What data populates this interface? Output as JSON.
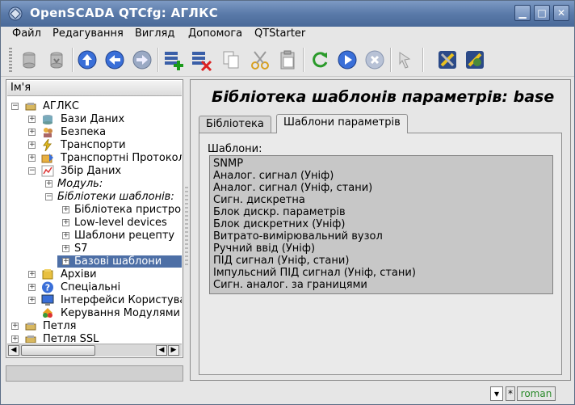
{
  "window": {
    "title": "OpenSCADA QTCfg: АГЛКС"
  },
  "menu": [
    {
      "label": "Файл"
    },
    {
      "label": "Редагування"
    },
    {
      "label": "Вигляд"
    },
    {
      "label": "Допомога"
    },
    {
      "label": "QTStarter"
    }
  ],
  "tree": {
    "header": "Ім'я",
    "nodes": [
      {
        "label": "АГЛКС",
        "icon": "station-icon"
      },
      {
        "label": "Бази Даних",
        "icon": "database-icon"
      },
      {
        "label": "Безпека",
        "icon": "security-icon"
      },
      {
        "label": "Транспорти",
        "icon": "lightning-icon"
      },
      {
        "label": "Транспортні Протокол",
        "icon": "protocol-icon"
      },
      {
        "label": "Збір Даних",
        "icon": "chart-icon"
      },
      {
        "label": "Модуль:"
      },
      {
        "label": "Бібліотеки шаблонів:"
      },
      {
        "label": "Бібліотека пристро"
      },
      {
        "label": "Low-level devices"
      },
      {
        "label": "Шаблони рецепту"
      },
      {
        "label": "S7"
      },
      {
        "label": "Базові шаблони"
      },
      {
        "label": "Архіви",
        "icon": "archive-icon"
      },
      {
        "label": "Спеціальні",
        "icon": "help-icon"
      },
      {
        "label": "Інтерфейси Користува",
        "icon": "monitor-icon"
      },
      {
        "label": "Керування Модулями",
        "icon": "modules-icon"
      },
      {
        "label": "Петля",
        "icon": "station-icon"
      },
      {
        "label": "Петля SSL",
        "icon": "station-icon"
      }
    ]
  },
  "page": {
    "title": "Бібліотека шаблонів параметрів: base",
    "tabs": [
      {
        "label": "Бібліотека"
      },
      {
        "label": "Шаблони параметрів"
      }
    ],
    "templates_label": "Шаблони:",
    "templates": [
      "SNMP",
      "Аналог. сигнал (Уніф)",
      "Аналог. сигнал (Уніф, стани)",
      "Сигн. дискретна",
      "Блок дискр. параметрів",
      "Блок дискретних (Уніф)",
      "Витрато-вимірювальний вузол",
      "Ручний ввід (Уніф)",
      "ПІД сигнал (Уніф, стани)",
      "Імпульсний ПІД сигнал (Уніф, стани)",
      "Сигн. аналог. за границями"
    ]
  },
  "statusbar": {
    "modified": "*",
    "user": "roman"
  },
  "colors": {
    "titlebar": "#5a7aa9",
    "selection": "#4d6fa6",
    "user_text": "#2a8a2a"
  }
}
